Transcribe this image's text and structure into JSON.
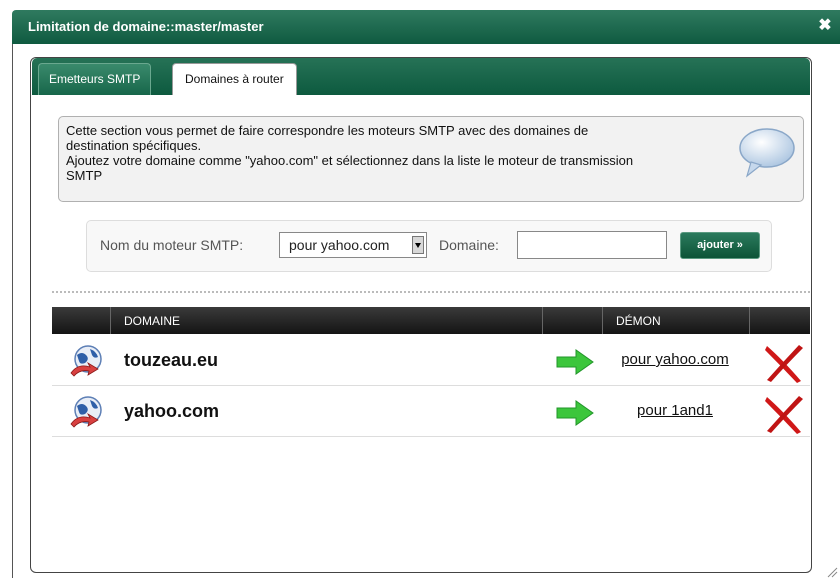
{
  "window": {
    "title": "Limitation de domaine::master/master",
    "close_glyph": "✖"
  },
  "tabs": [
    {
      "label": "Emetteurs SMTP",
      "active": false
    },
    {
      "label": "Domaines à router",
      "active": true
    }
  ],
  "info": {
    "lines": [
      "Cette section vous permet de faire correspondre les moteurs SMTP avec des domaines de",
      "destination spécifiques.",
      "Ajoutez votre domaine comme \"yahoo.com\" et sélectionnez dans la liste le moteur de transmission",
      "SMTP"
    ],
    "icon": "speech-bubble-icon"
  },
  "form": {
    "smtp_label": "Nom du moteur SMTP:",
    "smtp_selected": "pour yahoo.com",
    "domain_label": "Domaine:",
    "domain_value": "",
    "add_button": "ajouter »"
  },
  "table": {
    "headers": {
      "domain": "DOMAINE",
      "demon": "DÉMON"
    },
    "rows": [
      {
        "domain": "touzeau.eu",
        "demon": "pour yahoo.com"
      },
      {
        "domain": "yahoo.com",
        "demon": "pour 1and1"
      }
    ]
  },
  "colors": {
    "accent_green": "#0f5a40",
    "header_dark": "#1a1a1a",
    "arrow_green": "#3cc63c",
    "delete_red": "#d01818"
  }
}
